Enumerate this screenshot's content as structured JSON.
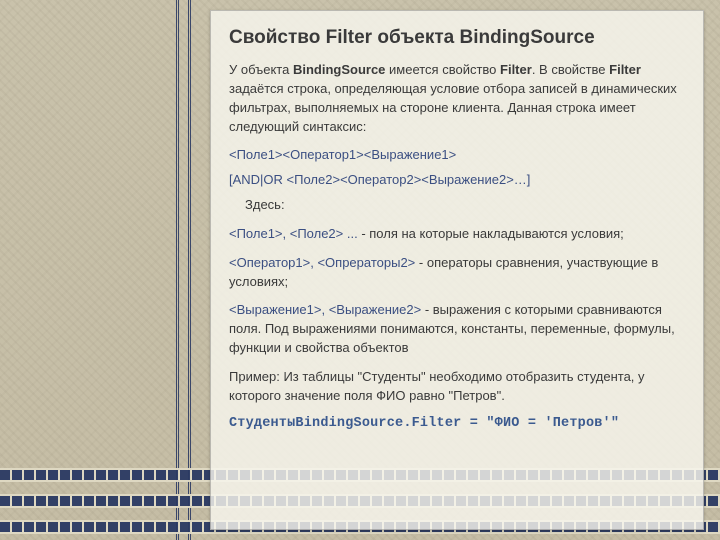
{
  "title": "Свойство Filter объекта BindingSource",
  "intro": {
    "p1a": "У объекта ",
    "p1b": "BindingSource",
    "p1c": " имеется свойство ",
    "p1d": "Filter",
    "p1e": ". В свойстве ",
    "p1f": "Filter",
    "p1g": " задаётся строка, определяющая условие отбора записей в динамических фильтрах, выполняемых на стороне клиента. Данная строка имеет следующий синтаксис:"
  },
  "syntax": {
    "line1": "<Поле1><Оператор1><Выражение1>",
    "line2": "[AND|OR <Поле2><Оператор2><Выражение2>…]"
  },
  "here_label": "Здесь:",
  "defs": {
    "d1_term": "<Поле1>, <Поле2> ...",
    "d1_text": " - поля на которые накладываются условия;",
    "d2_term": "<Оператор1>, <Опрераторы2>",
    "d2_text": " - операторы сравнения, участвующие в условиях;",
    "d3_term": "<Выражение1>, <Выражение2>",
    "d3_text_a": " - выражения с которыми сравниваются поля. Под ",
    "d3_text_i": "выражениями",
    "d3_text_b": " понимаются, константы, переменные, формулы, функции и свойства объектов"
  },
  "example_intro": "Пример: Из таблицы \"Студенты\" необходимо отобразить студента, у которого значение поля ФИО равно \"Петров\".",
  "code_line": "СтудентыBindingSource.Filter = \"ФИО = 'Петров'\""
}
